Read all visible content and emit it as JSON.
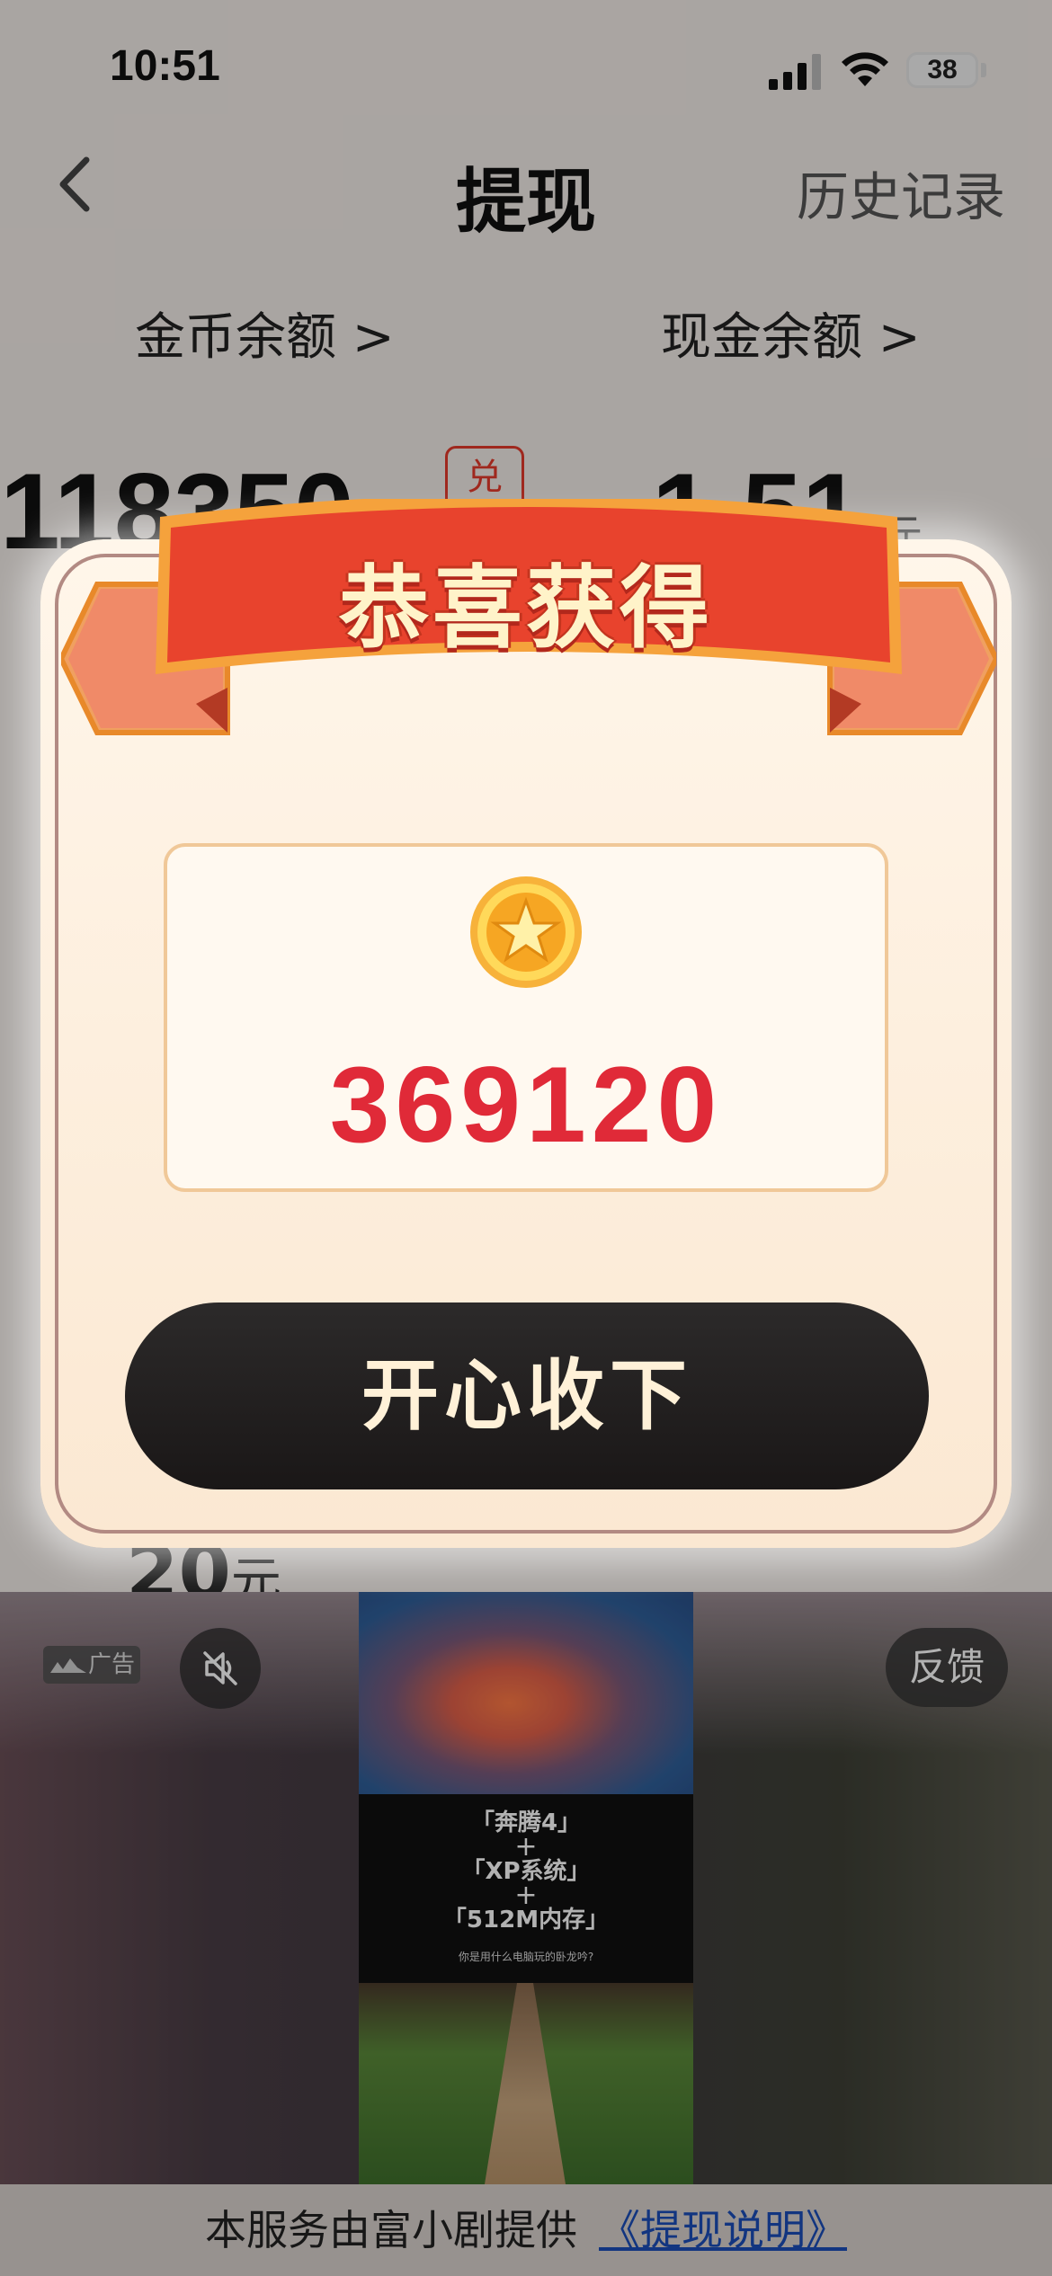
{
  "status_bar": {
    "time": "10:51",
    "battery": "38"
  },
  "nav": {
    "title": "提现",
    "history": "历史记录"
  },
  "balances": {
    "coin_label": "金币余额 >",
    "cash_label": "现金余额 >",
    "coin_value": "118350",
    "exchange_badge": "兑",
    "cash_value": "1.51",
    "cash_unit": "元"
  },
  "withdraw_option": {
    "amount": "20",
    "unit": "元"
  },
  "modal": {
    "title": "恭喜获得",
    "reward_amount": "369120",
    "accept_label": "开心收下"
  },
  "ad": {
    "badge": "广告",
    "feedback": "反馈",
    "video_lines": [
      "「奔腾4」",
      "+",
      "「XP系统」",
      "+",
      "「512M内存」"
    ],
    "video_caption": "你是用什么电脑玩的卧龙吟?"
  },
  "footer": {
    "text": "本服务由富小剧提供",
    "link": "《提现说明》"
  },
  "colors": {
    "accent_red": "#e02a38",
    "button_dark": "#1f1c1c",
    "ribbon_red": "#e8432d"
  }
}
